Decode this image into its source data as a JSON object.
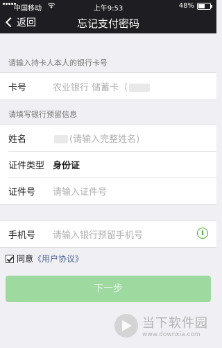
{
  "status_bar": {
    "carrier": "中国移动",
    "time": "上午9:53",
    "battery": "48%",
    "battery_level": 0.48
  },
  "nav": {
    "back_label": "返回",
    "title": "忘记支付密码"
  },
  "card_section": {
    "header": "请输入持卡人本人的银行卡号",
    "card_label": "卡号",
    "card_value": "农业银行 储蓄卡（"
  },
  "info_section": {
    "header": "请填写银行预留信息",
    "name_label": "姓名",
    "name_placeholder": "(请输入完整姓名)",
    "id_type_label": "证件类型",
    "id_type_value": "身份证",
    "id_no_label": "证件号",
    "id_no_placeholder": "请输入证件号"
  },
  "phone_section": {
    "phone_label": "手机号",
    "phone_placeholder": "请输入银行预留手机号",
    "info_icon_glyph": "i"
  },
  "agreement": {
    "prefix": "同意",
    "link": "《用户协议》",
    "checked": true
  },
  "next_button": "下一步",
  "watermark": {
    "brand": "当下软件园",
    "url": "www.downxia.com"
  },
  "colors": {
    "nav_bg": "#1e1e22",
    "accent_green": "#43b02a",
    "button_disabled": "#9ed99f",
    "link_blue": "#576b95"
  }
}
